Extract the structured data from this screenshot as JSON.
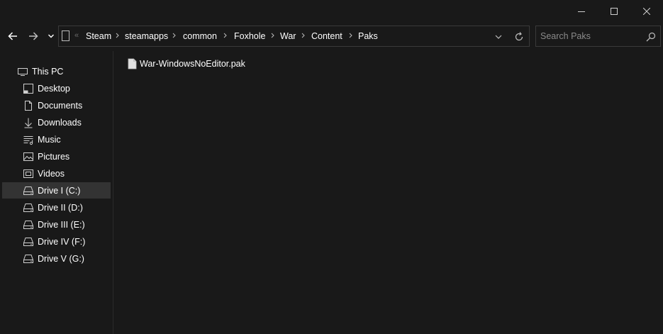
{
  "window_controls": {
    "minimize": "minimize",
    "maximize": "maximize",
    "close": "close"
  },
  "address": {
    "overflow": "«",
    "crumbs": [
      "Steam",
      "steamapps",
      "common",
      "Foxhole",
      "War",
      "Content",
      "Paks"
    ]
  },
  "search": {
    "placeholder": "Search Paks",
    "value": ""
  },
  "sidebar": {
    "items": [
      {
        "label": "This PC",
        "icon": "monitor-icon"
      },
      {
        "label": "Desktop",
        "icon": "desktop-icon"
      },
      {
        "label": "Documents",
        "icon": "document-icon"
      },
      {
        "label": "Downloads",
        "icon": "download-icon"
      },
      {
        "label": "Music",
        "icon": "music-icon"
      },
      {
        "label": "Pictures",
        "icon": "picture-icon"
      },
      {
        "label": "Videos",
        "icon": "video-icon"
      },
      {
        "label": "Drive I (C:)",
        "icon": "drive-icon",
        "selected": true
      },
      {
        "label": "Drive II (D:)",
        "icon": "drive-icon"
      },
      {
        "label": "Drive III (E:)",
        "icon": "drive-icon"
      },
      {
        "label": "Drive IV (F:)",
        "icon": "drive-icon"
      },
      {
        "label": "Drive V (G:)",
        "icon": "drive-icon"
      }
    ]
  },
  "files": [
    {
      "name": "War-WindowsNoEditor.pak",
      "icon": "file-icon"
    }
  ],
  "colors": {
    "background": "#191919",
    "selected": "#333333",
    "border": "#3a3a3a",
    "text": "#ffffff"
  }
}
